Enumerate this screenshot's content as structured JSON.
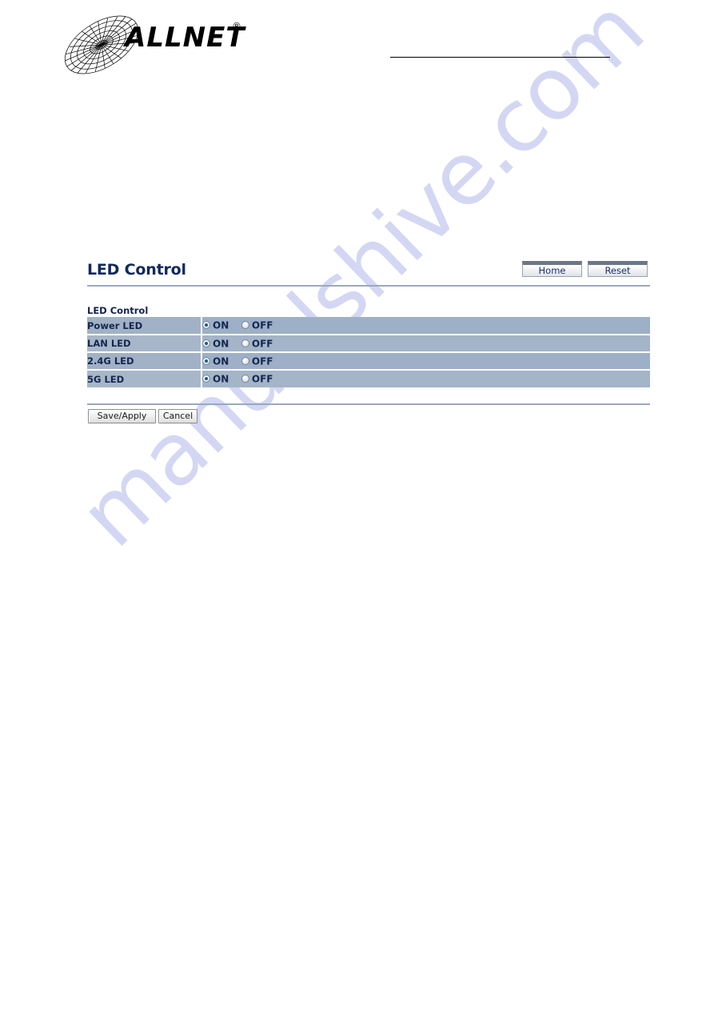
{
  "brand": {
    "name": "ALLNET",
    "registered_mark": "®",
    "logo_icon": "allnet-globe-wireframe-logo"
  },
  "header": {
    "rule": "header-horizontal-rule"
  },
  "page": {
    "title": "LED Control",
    "buttons": [
      {
        "name": "home-button",
        "label": "Home"
      },
      {
        "name": "reset-button",
        "label": "Reset"
      }
    ]
  },
  "section": {
    "label": "LED Control",
    "rows": [
      {
        "label": "Power LED",
        "options": [
          {
            "label": "ON",
            "selected": true
          },
          {
            "label": "OFF",
            "selected": false
          }
        ]
      },
      {
        "label": "LAN LED",
        "options": [
          {
            "label": "ON",
            "selected": true
          },
          {
            "label": "OFF",
            "selected": false
          }
        ]
      },
      {
        "label": "2.4G LED",
        "options": [
          {
            "label": "ON",
            "selected": true
          },
          {
            "label": "OFF",
            "selected": false
          }
        ]
      },
      {
        "label": "5G LED",
        "options": [
          {
            "label": "ON",
            "selected": true
          },
          {
            "label": "OFF",
            "selected": false
          }
        ]
      }
    ]
  },
  "form_actions": {
    "save_label": "Save/Apply",
    "cancel_label": "Cancel"
  },
  "watermark": {
    "text": "manualshive.com"
  },
  "colors": {
    "title": "#10295c",
    "row_label_bg": "#a1b1c6",
    "row_value_bg": "#9db0c7",
    "row_alt_label_bg": "#a8b6c9",
    "row_alt_value_bg": "#a4b4c9",
    "rule": "#9aa9be",
    "radio_selected": "#13608f",
    "watermark": "#c9cdf0",
    "button_text": "#17306b",
    "button_top_bar": "#6d7685"
  }
}
